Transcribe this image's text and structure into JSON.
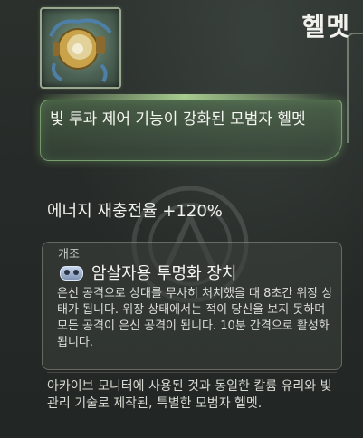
{
  "item": {
    "name": "헬멧",
    "icon": "helmet-item-icon",
    "subtitle": "빛 투과 제어 기능이 강화된 모범자 헬멧"
  },
  "stats": {
    "line": "에너지 재충전율 +120%"
  },
  "modification": {
    "section_label": "개조",
    "icon": "mod-chip-icon",
    "name": "암살자용 투명화 장치",
    "description": "은신 공격으로 상대를 무사히 처치했을 때 8초간 위장 상태가 됩니다. 위장 상태에서는 적이 당신을 보지 못하며 모든 공격이 은신 공격이 됩니다. 10분 간격으로 활성화됩니다."
  },
  "flavor_text": "아카이브 모니터에 사용된 것과 동일한 칼륨 유리와 빛 관리 기술로 제작된, 특별한 모범자 헬멧.",
  "colors": {
    "panel_glow": "#a0dc90",
    "title_text": "#f2f2ec",
    "background": "#262a28"
  }
}
